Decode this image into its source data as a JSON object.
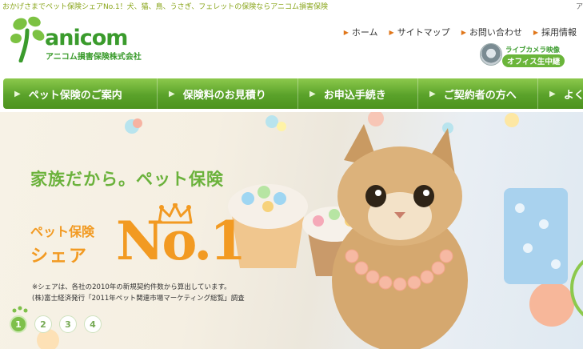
{
  "top_strip": {
    "tagline": "おかげさまでペット保険シェアNo.1！犬、猫、鳥、うさぎ、フェレットの保険ならアニコム損害保険",
    "edge_text": "ア"
  },
  "header": {
    "logo_word": "anicom",
    "logo_sub": "アニコム損害保険株式会社",
    "util_links": [
      "ホーム",
      "サイトマップ",
      "お問い合わせ",
      "採用情報"
    ],
    "livecam_line1": "ライブカメラ映像",
    "livecam_line2": "オフィス生中継"
  },
  "nav": {
    "items": [
      "ペット保険のご案内",
      "保険料のお見積り",
      "お申込手続き",
      "ご契約者の方へ",
      "よく"
    ]
  },
  "hero": {
    "title": "家族だから。ペット保険",
    "pet_line1": "ペット保険",
    "pet_line2": "シェア",
    "no1": "No.1",
    "note1": "※シェアは、各社の2010年の新規契約件数から算出しています。",
    "note2": "(株)富士経済発行「2011年ペット関連市場マーケティング総覧」調査",
    "pages": [
      "1",
      "2",
      "3",
      "4"
    ],
    "active_page": "1"
  },
  "colors": {
    "brand_green": "#3a9b2c",
    "nav_green": "#5aa22a",
    "accent_orange": "#f29a22",
    "link_arrow": "#e0761a"
  }
}
